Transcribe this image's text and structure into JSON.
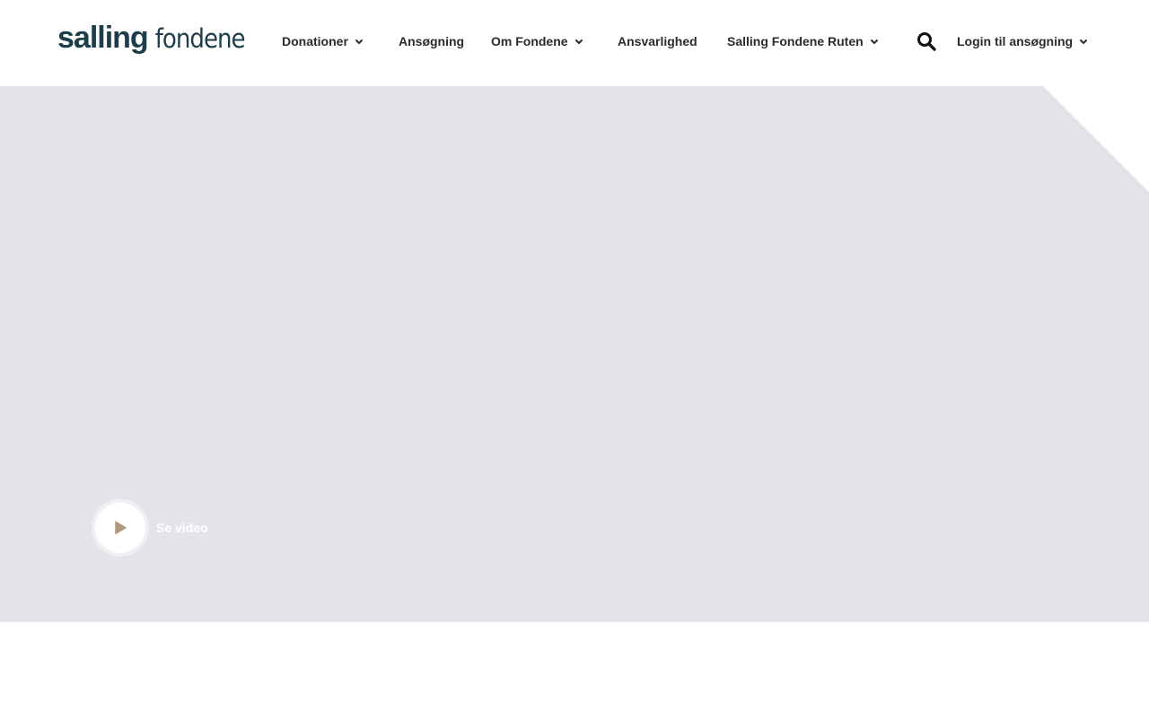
{
  "brand": {
    "logo_bold": "salling",
    "logo_light": "fondene",
    "primary_color": "#1d3d4b"
  },
  "nav": {
    "items": [
      {
        "label": "Donationer",
        "has_dropdown": true
      },
      {
        "label": "Ansøgning",
        "has_dropdown": false
      },
      {
        "label": "Om Fondene",
        "has_dropdown": true
      },
      {
        "label": "Ansvarlighed",
        "has_dropdown": false
      },
      {
        "label": "Salling Fondene Ruten",
        "has_dropdown": true
      }
    ],
    "search_icon": "search-icon",
    "login": {
      "label": "Login til ansøgning",
      "has_dropdown": true
    }
  },
  "hero": {
    "background_color": "#e3e4ea",
    "video": {
      "label": "Se video",
      "icon": "play-icon",
      "icon_color": "#b09a7e"
    }
  }
}
